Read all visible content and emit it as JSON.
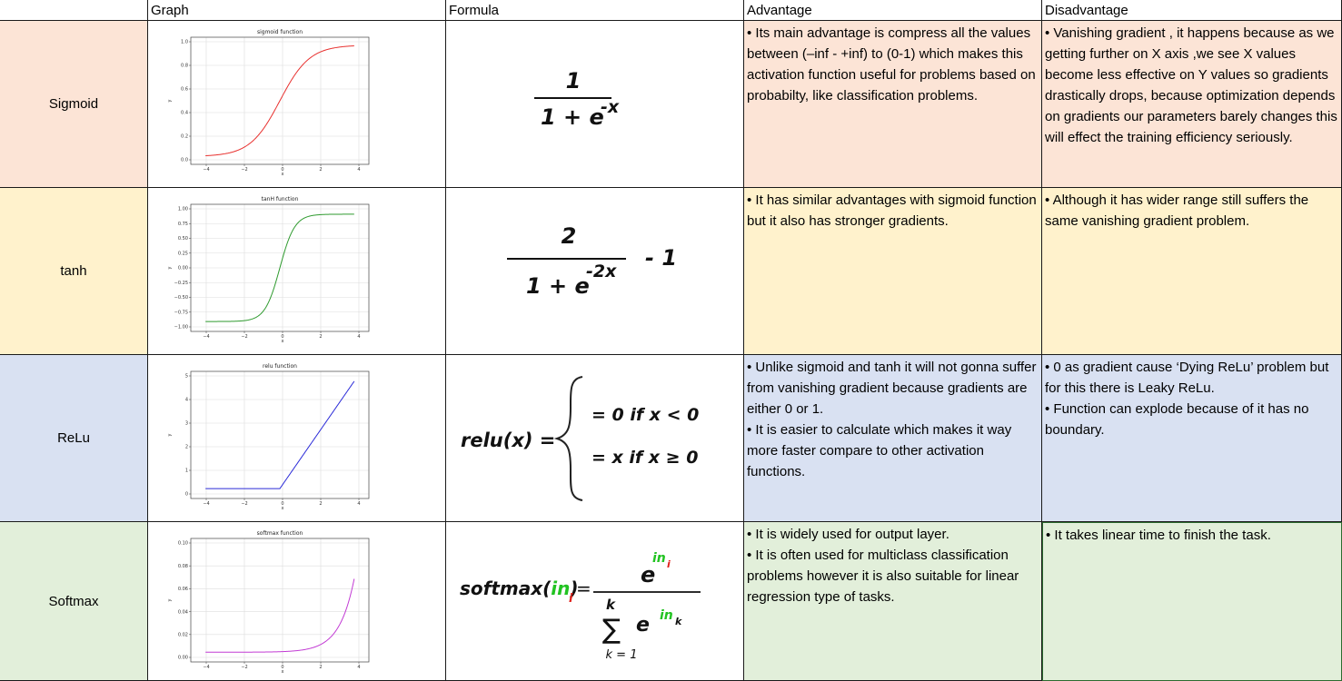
{
  "headers": [
    "",
    "Graph",
    "Formula",
    "Advantage",
    "Disadvantage"
  ],
  "rows": [
    {
      "name": "Sigmoid",
      "color": "#fce4d6",
      "graph": {
        "title": "sigmoid function",
        "ylabel": "y",
        "xlabel": "x",
        "line_color": "#e8302e",
        "yticks": [
          "0.0",
          "0.2",
          "0.4",
          "0.6",
          "0.8",
          "1.0"
        ],
        "xticks": [
          "−4",
          "−2",
          "0",
          "2",
          "4"
        ]
      },
      "formula": {
        "numerator": "1",
        "denominator_base": "1 + e",
        "exponent": "-x"
      },
      "advantage": [
        "• Its main advantage is compress all the values between (–inf - +inf) to (0-1) which makes this activation function useful for problems based on probabilty, like classification problems."
      ],
      "disadvantage": [
        "• Vanishing gradient , it happens because as we getting further on X axis ,we see X values become less effective on Y values so gradients drastically drops, because optimization depends on gradients our parameters barely changes this will effect the training efficiency seriously."
      ]
    },
    {
      "name": "tanh",
      "color": "#fff2cc",
      "graph": {
        "title": "tanH function",
        "ylabel": "y",
        "xlabel": "x",
        "line_color": "#2e9a2e",
        "yticks": [
          "−1.00",
          "−0.75",
          "−0.50",
          "−0.25",
          "0.00",
          "0.25",
          "0.50",
          "0.75",
          "1.00"
        ],
        "xticks": [
          "−4",
          "−2",
          "0",
          "2",
          "4"
        ]
      },
      "formula": {
        "numerator": "2",
        "denominator_base": "1 + e",
        "exponent": "-2x",
        "suffix": "- 1"
      },
      "advantage": [
        "• It has similar advantages with sigmoid function but it also has stronger gradients."
      ],
      "disadvantage": [
        "• Although it has wider range still suffers the same vanishing gradient problem."
      ]
    },
    {
      "name": "ReLu",
      "color": "#d9e1f2",
      "graph": {
        "title": "relu function",
        "ylabel": "y",
        "xlabel": "x",
        "line_color": "#2b2bd8",
        "yticks": [
          "0",
          "1",
          "2",
          "3",
          "4",
          "5"
        ],
        "xticks": [
          "−4",
          "−2",
          "0",
          "2",
          "4"
        ]
      },
      "formula": {
        "lhs": "relu(x) =",
        "case1": "= 0 if x < 0",
        "case2": "= x if x ≥ 0"
      },
      "advantage": [
        "• Unlike sigmoid and tanh it will not gonna suffer from vanishing gradient because gradients are either 0 or 1.",
        "• It is easier to calculate which makes it way more faster compare to other activation functions."
      ],
      "disadvantage": [
        "• 0 as gradient cause ‘Dying ReLu’ problem but for this there is Leaky ReLu.",
        "• Function can explode because of it has no boundary."
      ]
    },
    {
      "name": "Softmax",
      "color": "#e2efda",
      "graph": {
        "title": "softmax function",
        "ylabel": "y",
        "xlabel": "x",
        "line_color": "#c23bd4",
        "yticks": [
          "0.00",
          "0.02",
          "0.04",
          "0.06",
          "0.08",
          "0.10"
        ],
        "xticks": [
          "−4",
          "−2",
          "0",
          "2",
          "4"
        ]
      },
      "formula": {
        "lhs_name": "softmax(",
        "lhs_var": "in",
        "lhs_close": ")",
        "lhs_sub": "i",
        "equals": "=",
        "num_base": "e",
        "num_exp": "in",
        "num_exp_sub": "i",
        "sum_top": "k",
        "sum_sign": "∑",
        "sum_bottom": "k = 1",
        "den_base": "e",
        "den_exp": "in",
        "den_exp_sub": "k",
        "green": "#22c322",
        "red": "#e0201a"
      },
      "advantage": [
        "• It is widely used for output layer.",
        "• It is often used for multiclass classification problems however it is also suitable for linear regression type of tasks."
      ],
      "disadvantage": [
        "• It takes linear time to finish the task."
      ]
    }
  ]
}
